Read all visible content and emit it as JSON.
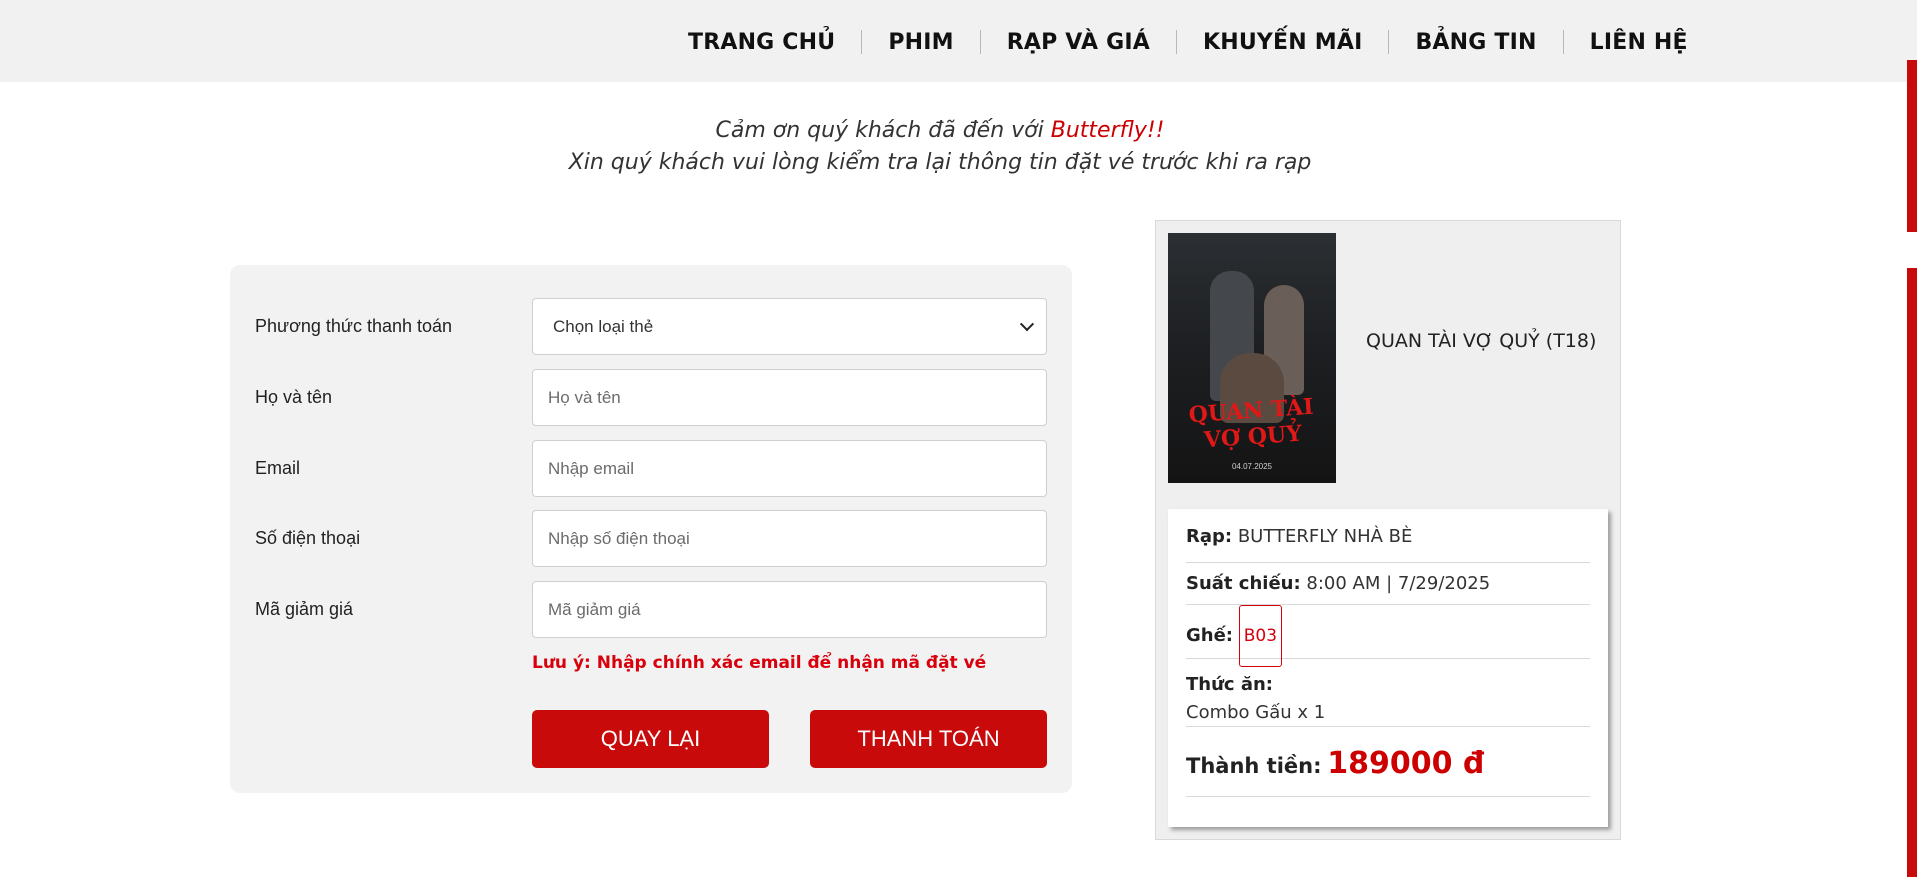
{
  "nav": {
    "items": [
      "TRANG CHỦ",
      "PHIM",
      "RẠP VÀ GIÁ",
      "KHUYẾN MÃI",
      "BẢNG TIN",
      "LIÊN HỆ"
    ]
  },
  "thanks": {
    "line1_prefix": "Cảm ơn quý khách đã đến với ",
    "brand": "Butterfly!!",
    "line2": "Xin quý khách vui lòng kiểm tra lại thông tin đặt vé trước khi ra rạp"
  },
  "form": {
    "payment_label": "Phương thức thanh toán",
    "payment_value": "Chọn loại thẻ",
    "name_label": "Họ và tên",
    "name_placeholder": "Họ và tên",
    "email_label": "Email",
    "email_placeholder": "Nhập email",
    "phone_label": "Số điện thoại",
    "phone_placeholder": "Nhập số điện thoại",
    "coupon_label": "Mã giảm giá",
    "coupon_placeholder": "Mã giảm giá",
    "note": "Lưu ý: Nhập chính xác email để nhận mã đặt vé",
    "back_button": "QUAY LẠI",
    "pay_button": "THANH TOÁN"
  },
  "summary": {
    "poster_title_line1": "QUAN TÀI",
    "poster_title_line2": "VỢ QUỶ",
    "poster_date": "04.07.2025",
    "movie_title": "QUAN TÀI VỢ QUỶ (T18)",
    "cinema_label": "Rạp:",
    "cinema_value": "BUTTERFLY NHÀ BÈ",
    "showtime_label": "Suất chiếu:",
    "showtime_value": "8:00 AM | 7/29/2025",
    "seat_label": "Ghế:",
    "seat_value": "B03",
    "food_label": "Thức ăn:",
    "food_value": "Combo Gấu x 1",
    "total_label": "Thành tiền:",
    "total_value": "189000 đ"
  },
  "colors": {
    "accent": "#c90a0a",
    "note_red": "#d8000c",
    "header_bg": "#f1f1f1"
  }
}
